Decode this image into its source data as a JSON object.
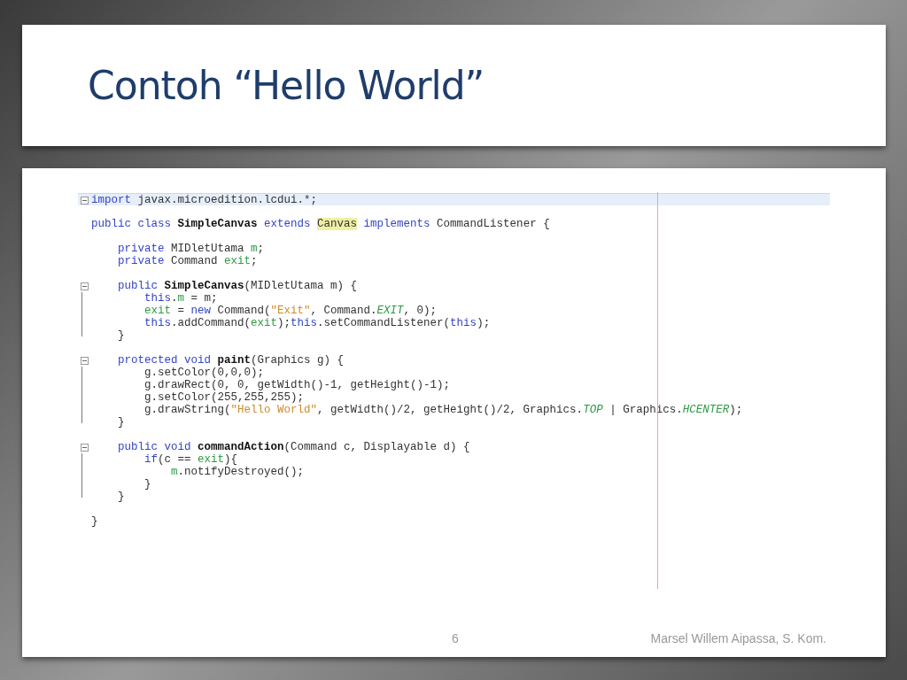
{
  "slide": {
    "title": "Contoh “Hello World”",
    "page_number": "6",
    "author": "Marsel Willem Aipassa, S. Kom."
  },
  "editor": {
    "blocks": [
      {
        "foldable": true,
        "lines": [
          {
            "current": true,
            "tokens": [
              {
                "text": "import ",
                "kind": "kw"
              },
              {
                "text": "javax.microedition.lcdui.*;",
                "kind": "plain"
              }
            ]
          }
        ]
      },
      {
        "foldable": false,
        "lines": [
          {
            "current": false,
            "tokens": [
              {
                "text": "public class ",
                "kind": "kw"
              },
              {
                "text": "SimpleCanvas ",
                "kind": "decl"
              },
              {
                "text": "extends ",
                "kind": "kw"
              },
              {
                "text": "Canvas",
                "kind": "mark"
              },
              {
                "text": " implements ",
                "kind": "kw"
              },
              {
                "text": "CommandListener {",
                "kind": "plain"
              }
            ]
          }
        ]
      },
      {
        "foldable": false,
        "lines": [
          {
            "current": false,
            "tokens": [
              {
                "text": "    private ",
                "kind": "kw"
              },
              {
                "text": "MIDletUtama ",
                "kind": "plain"
              },
              {
                "text": "m",
                "kind": "field"
              },
              {
                "text": ";",
                "kind": "plain"
              }
            ]
          },
          {
            "current": false,
            "tokens": [
              {
                "text": "    private ",
                "kind": "kw"
              },
              {
                "text": "Command ",
                "kind": "plain"
              },
              {
                "text": "exit",
                "kind": "field"
              },
              {
                "text": ";",
                "kind": "plain"
              }
            ]
          }
        ]
      },
      {
        "foldable": true,
        "lines": [
          {
            "current": false,
            "tokens": [
              {
                "text": "    public ",
                "kind": "kw"
              },
              {
                "text": "SimpleCanvas",
                "kind": "decl"
              },
              {
                "text": "(MIDletUtama m) {",
                "kind": "plain"
              }
            ]
          },
          {
            "current": false,
            "tokens": [
              {
                "text": "        this",
                "kind": "kw"
              },
              {
                "text": ".",
                "kind": "plain"
              },
              {
                "text": "m",
                "kind": "field"
              },
              {
                "text": " = m;",
                "kind": "plain"
              }
            ]
          },
          {
            "current": false,
            "tokens": [
              {
                "text": "        exit",
                "kind": "field"
              },
              {
                "text": " = ",
                "kind": "plain"
              },
              {
                "text": "new",
                "kind": "kw"
              },
              {
                "text": " Command(",
                "kind": "plain"
              },
              {
                "text": "\"Exit\"",
                "kind": "str"
              },
              {
                "text": ", Command.",
                "kind": "plain"
              },
              {
                "text": "EXIT",
                "kind": "const"
              },
              {
                "text": ", 0);",
                "kind": "plain"
              }
            ]
          },
          {
            "current": false,
            "tokens": [
              {
                "text": "        this",
                "kind": "kw"
              },
              {
                "text": ".addCommand(",
                "kind": "plain"
              },
              {
                "text": "exit",
                "kind": "field"
              },
              {
                "text": ");",
                "kind": "plain"
              },
              {
                "text": "this",
                "kind": "kw"
              },
              {
                "text": ".setCommandListener(",
                "kind": "plain"
              },
              {
                "text": "this",
                "kind": "kw"
              },
              {
                "text": ");",
                "kind": "plain"
              }
            ]
          },
          {
            "current": false,
            "tokens": [
              {
                "text": "    }",
                "kind": "plain"
              }
            ]
          }
        ]
      },
      {
        "foldable": true,
        "lines": [
          {
            "current": false,
            "tokens": [
              {
                "text": "    protected void ",
                "kind": "kw"
              },
              {
                "text": "paint",
                "kind": "decl"
              },
              {
                "text": "(Graphics g) {",
                "kind": "plain"
              }
            ]
          },
          {
            "current": false,
            "tokens": [
              {
                "text": "        g.setColor(0,0,0);",
                "kind": "plain"
              }
            ]
          },
          {
            "current": false,
            "tokens": [
              {
                "text": "        g.drawRect(0, 0, getWidth()-1, getHeight()-1);",
                "kind": "plain"
              }
            ]
          },
          {
            "current": false,
            "tokens": [
              {
                "text": "        g.setColor(255,255,255);",
                "kind": "plain"
              }
            ]
          },
          {
            "current": false,
            "tokens": [
              {
                "text": "        g.drawString(",
                "kind": "plain"
              },
              {
                "text": "\"Hello World\"",
                "kind": "str"
              },
              {
                "text": ", getWidth()/2, getHeight()/2, Graphics.",
                "kind": "plain"
              },
              {
                "text": "TOP",
                "kind": "const"
              },
              {
                "text": " | Graphics.",
                "kind": "plain"
              },
              {
                "text": "HCENTER",
                "kind": "const"
              },
              {
                "text": ");",
                "kind": "plain"
              }
            ]
          },
          {
            "current": false,
            "tokens": [
              {
                "text": "    }",
                "kind": "plain"
              }
            ]
          }
        ]
      },
      {
        "foldable": true,
        "lines": [
          {
            "current": false,
            "tokens": [
              {
                "text": "    public void ",
                "kind": "kw"
              },
              {
                "text": "commandAction",
                "kind": "decl"
              },
              {
                "text": "(Command c, Displayable d) {",
                "kind": "plain"
              }
            ]
          },
          {
            "current": false,
            "tokens": [
              {
                "text": "        if",
                "kind": "kw"
              },
              {
                "text": "(c == ",
                "kind": "plain"
              },
              {
                "text": "exit",
                "kind": "field"
              },
              {
                "text": "){",
                "kind": "plain"
              }
            ]
          },
          {
            "current": false,
            "tokens": [
              {
                "text": "            m",
                "kind": "field"
              },
              {
                "text": ".notifyDestroyed();",
                "kind": "plain"
              }
            ]
          },
          {
            "current": false,
            "tokens": [
              {
                "text": "        }",
                "kind": "plain"
              }
            ]
          },
          {
            "current": false,
            "tokens": [
              {
                "text": "    }",
                "kind": "plain"
              }
            ]
          }
        ]
      },
      {
        "foldable": false,
        "lines": [
          {
            "current": false,
            "tokens": [
              {
                "text": "}",
                "kind": "plain"
              }
            ]
          }
        ]
      }
    ]
  }
}
